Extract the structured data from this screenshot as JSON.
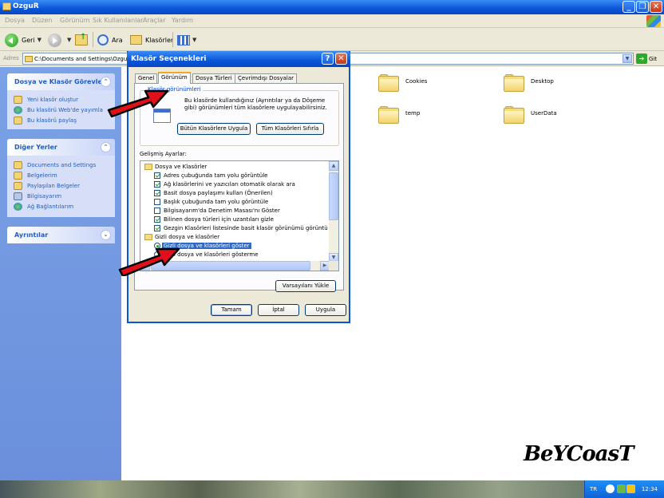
{
  "window": {
    "title": "OzguR"
  },
  "menubar": [
    "Dosya",
    "Düzen",
    "Görünüm",
    "Sık Kullanılanlar",
    "Araçlar",
    "Yardım"
  ],
  "toolbar": {
    "back": "Geri",
    "search": "Ara",
    "folders": "Klasörler"
  },
  "address": {
    "label": "Adres",
    "value": "C:\\Documents and Settings\\OzguR",
    "go": "Git"
  },
  "leftpane": {
    "tasks": {
      "title": "Dosya ve Klasör Görevleri",
      "items": [
        "Yeni klasör oluştur",
        "Bu klasörü Web'de yayımla",
        "Bu klasörü paylaş"
      ]
    },
    "places": {
      "title": "Diğer Yerler",
      "items": [
        "Documents and Settings",
        "Belgelerim",
        "Paylaşılan Belgeler",
        "Bilgisayarım",
        "Ağ Bağlantılarım"
      ]
    },
    "details": {
      "title": "Ayrıntılar"
    }
  },
  "folders": [
    "Cookies",
    "Desktop",
    "temp",
    "UserData"
  ],
  "dialog": {
    "title": "Klasör Seçenekleri",
    "tabs": [
      "Genel",
      "Görünüm",
      "Dosya Türleri",
      "Çevrimdışı Dosyalar"
    ],
    "active_tab": "Görünüm",
    "group_title": "Klasör görünümleri",
    "group_desc": "Bu klasörde kullandığınız (Ayrıntılar ya da Döşeme gibi) görünümleri tüm klasörlere uygulayabilirsiniz.",
    "apply_all": "Bütün Klasörlere Uygula",
    "reset_all": "Tüm Klasörleri Sıfırla",
    "advanced_label": "Gelişmiş Ayarlar:",
    "settings": [
      {
        "type": "folder",
        "label": "Dosya ve Klasörler",
        "checked": null
      },
      {
        "type": "check",
        "label": "Adres çubuğunda tam yolu görüntüle",
        "checked": true
      },
      {
        "type": "check",
        "label": "Ağ klasörlerini ve yazıcıları otomatik olarak ara",
        "checked": true
      },
      {
        "type": "check",
        "label": "Basit dosya paylaşımı kullan (Önerilen)",
        "checked": true
      },
      {
        "type": "check",
        "label": "Başlık çubuğunda tam yolu görüntüle",
        "checked": false
      },
      {
        "type": "check",
        "label": "Bilgisayarım'da Denetim Masası'nı Göster",
        "checked": false
      },
      {
        "type": "check",
        "label": "Bilinen dosya türleri için uzantıları gizle",
        "checked": true
      },
      {
        "type": "check",
        "label": "Gezgin Klasörleri listesinde basit klasör görünümü görüntü",
        "checked": true
      },
      {
        "type": "folder",
        "label": "Gizli dosya ve klasörler",
        "checked": null
      },
      {
        "type": "radio",
        "label": "Gizli dosya ve klasörleri göster",
        "checked": true
      },
      {
        "type": "radio",
        "label": "Gizli dosya ve klasörleri gösterme",
        "checked": false
      }
    ],
    "restore_defaults": "Varsayılanı Yükle",
    "ok": "Tamam",
    "cancel": "İptal",
    "apply": "Uygula"
  },
  "taskbar": {
    "lang": "TR",
    "time": "12:34"
  },
  "watermark": "BeYCoasT",
  "colors": {
    "xp_blue": "#0a55d8",
    "link_blue": "#215dc6",
    "selection": "#316ac5",
    "arrow_red": "#e0101a"
  }
}
